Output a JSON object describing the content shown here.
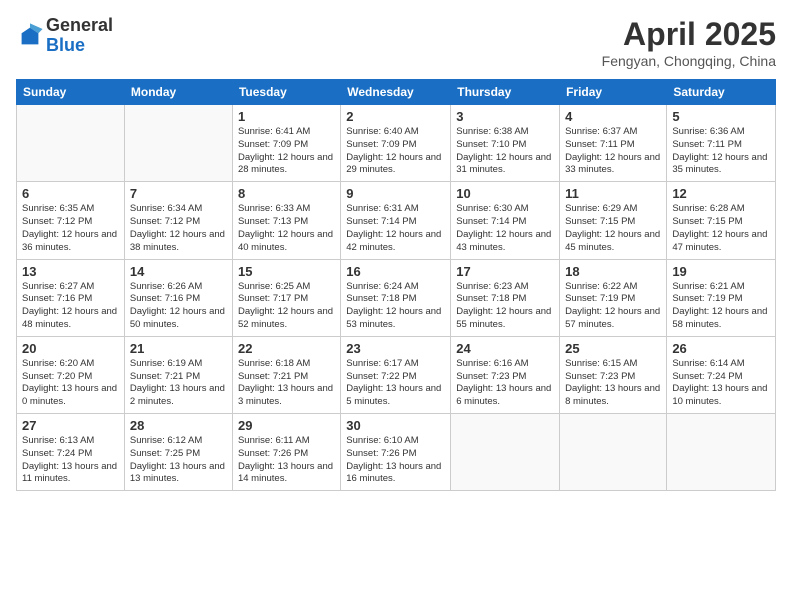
{
  "logo": {
    "general": "General",
    "blue": "Blue"
  },
  "title": "April 2025",
  "subtitle": "Fengyan, Chongqing, China",
  "days_of_week": [
    "Sunday",
    "Monday",
    "Tuesday",
    "Wednesday",
    "Thursday",
    "Friday",
    "Saturday"
  ],
  "weeks": [
    [
      {
        "day": "",
        "info": ""
      },
      {
        "day": "",
        "info": ""
      },
      {
        "day": "1",
        "info": "Sunrise: 6:41 AM\nSunset: 7:09 PM\nDaylight: 12 hours and 28 minutes."
      },
      {
        "day": "2",
        "info": "Sunrise: 6:40 AM\nSunset: 7:09 PM\nDaylight: 12 hours and 29 minutes."
      },
      {
        "day": "3",
        "info": "Sunrise: 6:38 AM\nSunset: 7:10 PM\nDaylight: 12 hours and 31 minutes."
      },
      {
        "day": "4",
        "info": "Sunrise: 6:37 AM\nSunset: 7:11 PM\nDaylight: 12 hours and 33 minutes."
      },
      {
        "day": "5",
        "info": "Sunrise: 6:36 AM\nSunset: 7:11 PM\nDaylight: 12 hours and 35 minutes."
      }
    ],
    [
      {
        "day": "6",
        "info": "Sunrise: 6:35 AM\nSunset: 7:12 PM\nDaylight: 12 hours and 36 minutes."
      },
      {
        "day": "7",
        "info": "Sunrise: 6:34 AM\nSunset: 7:12 PM\nDaylight: 12 hours and 38 minutes."
      },
      {
        "day": "8",
        "info": "Sunrise: 6:33 AM\nSunset: 7:13 PM\nDaylight: 12 hours and 40 minutes."
      },
      {
        "day": "9",
        "info": "Sunrise: 6:31 AM\nSunset: 7:14 PM\nDaylight: 12 hours and 42 minutes."
      },
      {
        "day": "10",
        "info": "Sunrise: 6:30 AM\nSunset: 7:14 PM\nDaylight: 12 hours and 43 minutes."
      },
      {
        "day": "11",
        "info": "Sunrise: 6:29 AM\nSunset: 7:15 PM\nDaylight: 12 hours and 45 minutes."
      },
      {
        "day": "12",
        "info": "Sunrise: 6:28 AM\nSunset: 7:15 PM\nDaylight: 12 hours and 47 minutes."
      }
    ],
    [
      {
        "day": "13",
        "info": "Sunrise: 6:27 AM\nSunset: 7:16 PM\nDaylight: 12 hours and 48 minutes."
      },
      {
        "day": "14",
        "info": "Sunrise: 6:26 AM\nSunset: 7:16 PM\nDaylight: 12 hours and 50 minutes."
      },
      {
        "day": "15",
        "info": "Sunrise: 6:25 AM\nSunset: 7:17 PM\nDaylight: 12 hours and 52 minutes."
      },
      {
        "day": "16",
        "info": "Sunrise: 6:24 AM\nSunset: 7:18 PM\nDaylight: 12 hours and 53 minutes."
      },
      {
        "day": "17",
        "info": "Sunrise: 6:23 AM\nSunset: 7:18 PM\nDaylight: 12 hours and 55 minutes."
      },
      {
        "day": "18",
        "info": "Sunrise: 6:22 AM\nSunset: 7:19 PM\nDaylight: 12 hours and 57 minutes."
      },
      {
        "day": "19",
        "info": "Sunrise: 6:21 AM\nSunset: 7:19 PM\nDaylight: 12 hours and 58 minutes."
      }
    ],
    [
      {
        "day": "20",
        "info": "Sunrise: 6:20 AM\nSunset: 7:20 PM\nDaylight: 13 hours and 0 minutes."
      },
      {
        "day": "21",
        "info": "Sunrise: 6:19 AM\nSunset: 7:21 PM\nDaylight: 13 hours and 2 minutes."
      },
      {
        "day": "22",
        "info": "Sunrise: 6:18 AM\nSunset: 7:21 PM\nDaylight: 13 hours and 3 minutes."
      },
      {
        "day": "23",
        "info": "Sunrise: 6:17 AM\nSunset: 7:22 PM\nDaylight: 13 hours and 5 minutes."
      },
      {
        "day": "24",
        "info": "Sunrise: 6:16 AM\nSunset: 7:23 PM\nDaylight: 13 hours and 6 minutes."
      },
      {
        "day": "25",
        "info": "Sunrise: 6:15 AM\nSunset: 7:23 PM\nDaylight: 13 hours and 8 minutes."
      },
      {
        "day": "26",
        "info": "Sunrise: 6:14 AM\nSunset: 7:24 PM\nDaylight: 13 hours and 10 minutes."
      }
    ],
    [
      {
        "day": "27",
        "info": "Sunrise: 6:13 AM\nSunset: 7:24 PM\nDaylight: 13 hours and 11 minutes."
      },
      {
        "day": "28",
        "info": "Sunrise: 6:12 AM\nSunset: 7:25 PM\nDaylight: 13 hours and 13 minutes."
      },
      {
        "day": "29",
        "info": "Sunrise: 6:11 AM\nSunset: 7:26 PM\nDaylight: 13 hours and 14 minutes."
      },
      {
        "day": "30",
        "info": "Sunrise: 6:10 AM\nSunset: 7:26 PM\nDaylight: 13 hours and 16 minutes."
      },
      {
        "day": "",
        "info": ""
      },
      {
        "day": "",
        "info": ""
      },
      {
        "day": "",
        "info": ""
      }
    ]
  ]
}
